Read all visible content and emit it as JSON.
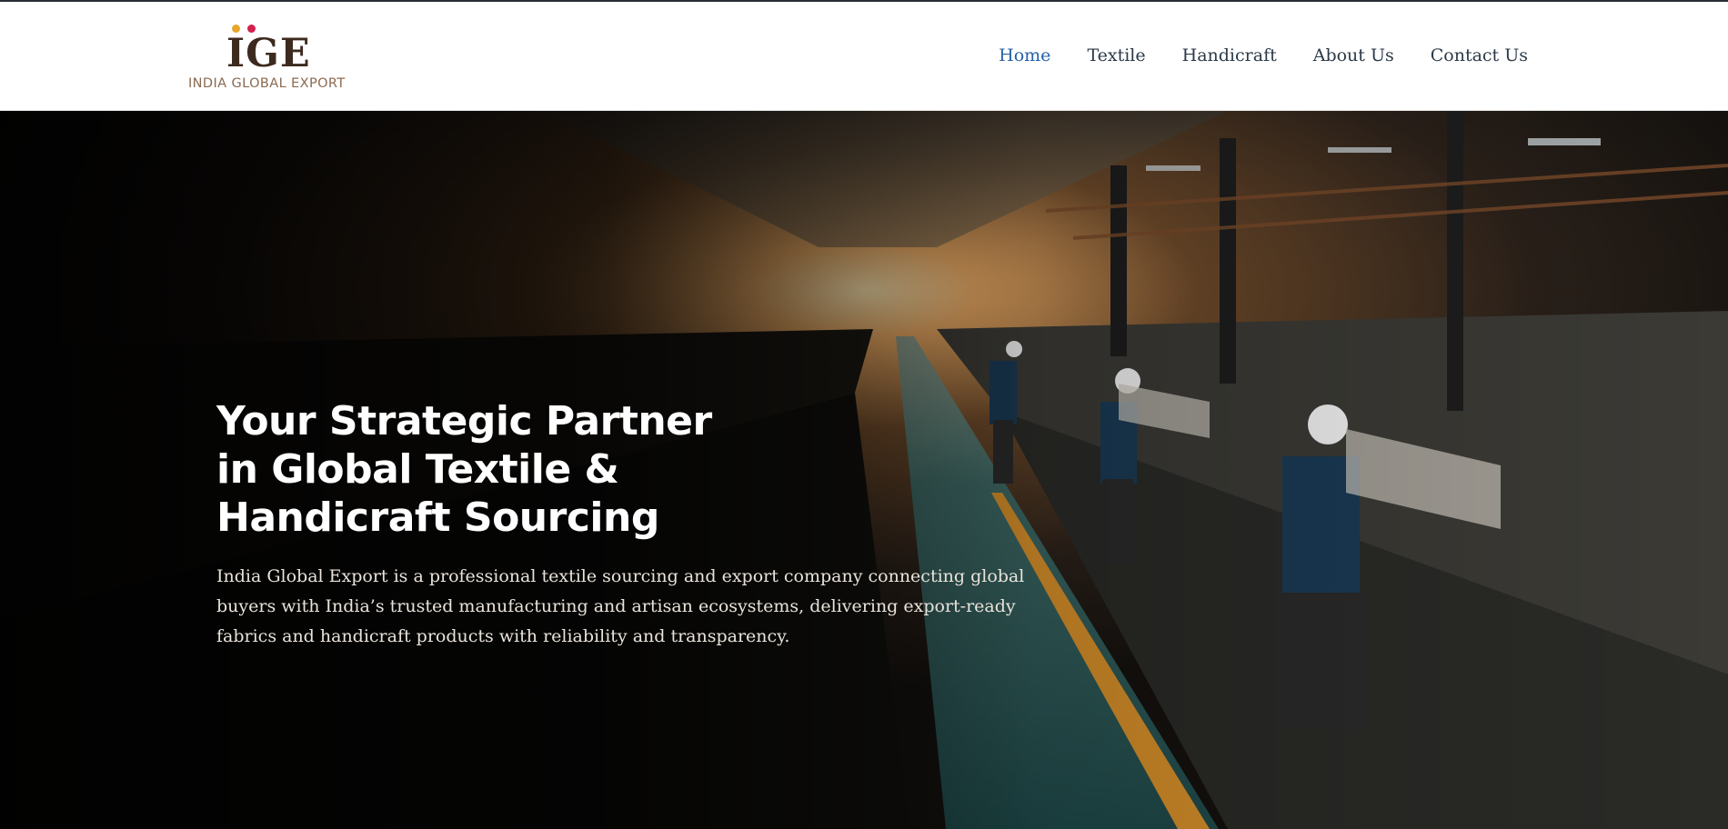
{
  "header": {
    "logo": {
      "mark": "IGE",
      "subtitle": "INDIA GLOBAL EXPORT"
    },
    "nav": [
      {
        "label": "Home",
        "active": true
      },
      {
        "label": "Textile",
        "active": false
      },
      {
        "label": "Handicraft",
        "active": false
      },
      {
        "label": "About Us",
        "active": false
      },
      {
        "label": "Contact Us",
        "active": false
      }
    ]
  },
  "hero": {
    "background": "textile-factory-photo",
    "title": "Your Strategic Partner in Global Textile & Handicraft Sourcing",
    "description": "India Global Export is a professional textile sourcing and export company connecting global buyers with India’s trusted manufacturing and artisan ecosystems, delivering export-ready fabrics and handicraft products with reliability and transparency."
  },
  "colors": {
    "nav_text": "#2b3947",
    "nav_active": "#2561a8",
    "logo_brown": "#3d2a1f",
    "logo_dot_yellow": "#e8a62c",
    "logo_dot_red": "#d2204f"
  }
}
